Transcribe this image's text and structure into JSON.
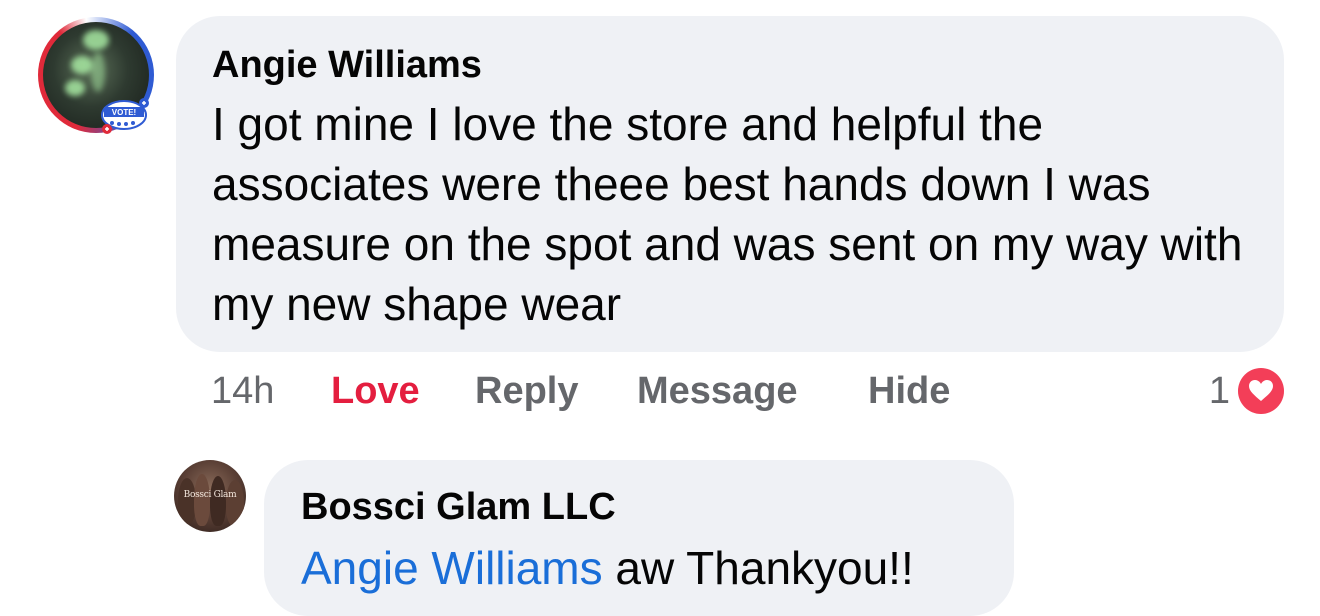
{
  "comment": {
    "author": "Angie Williams",
    "text": "I got mine I love the store and helpful the associates were theee best hands down I was measure on the spot and was sent on my way with my new shape wear",
    "avatar_badge_text": "VOTE!",
    "time": "14h",
    "actions": {
      "love": "Love",
      "reply": "Reply",
      "message": "Message",
      "hide": "Hide"
    },
    "reaction_count": "1",
    "reaction_icon": "heart-icon"
  },
  "reply": {
    "author": "Bossci Glam LLC",
    "avatar_text": "Bossci Glam",
    "mention": "Angie Williams",
    "text": " aw Thankyou!!"
  },
  "colors": {
    "bubble": "#eff1f5",
    "love": "#e41e3f",
    "mention": "#1a6ed8",
    "heart": "#f33e58",
    "secondary_text": "#65676b"
  }
}
